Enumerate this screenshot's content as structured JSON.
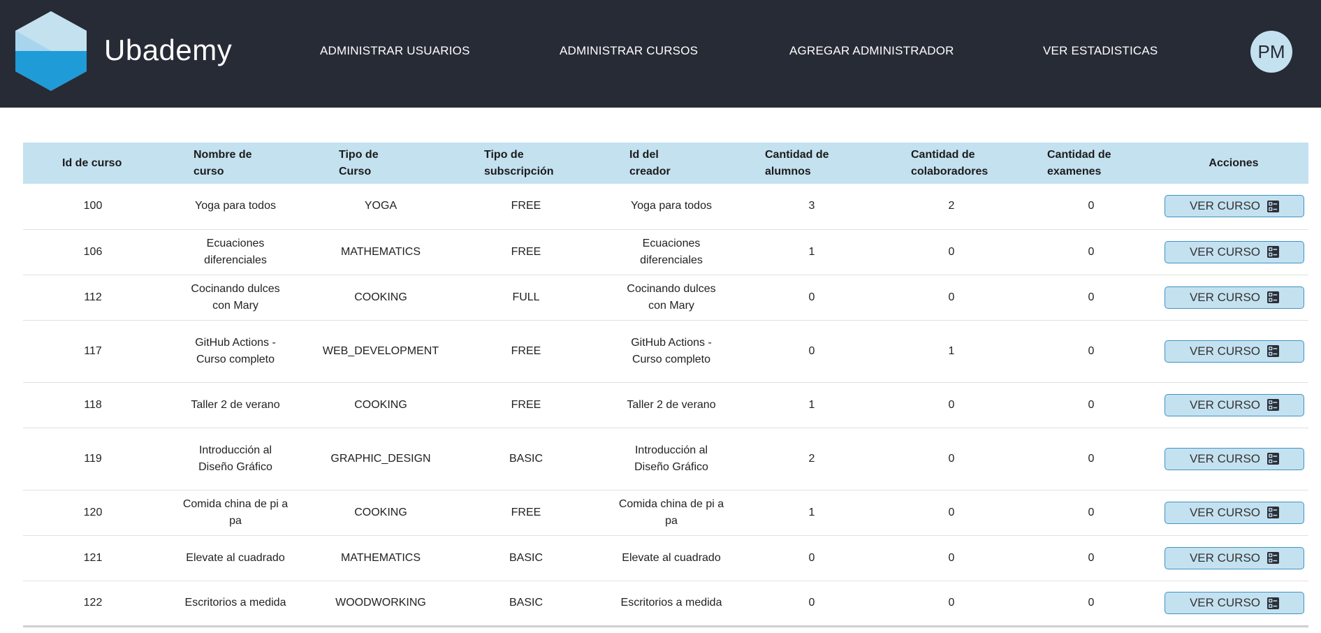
{
  "app": {
    "brand": "Ubademy",
    "avatar_initials": "PM",
    "colors": {
      "topbar": "#272b36",
      "header_row": "#c4e1f0",
      "button_border": "#3f93c4"
    }
  },
  "nav": {
    "items": [
      {
        "label": "ADMINISTRAR USUARIOS"
      },
      {
        "label": "ADMINISTRAR CURSOS"
      },
      {
        "label": "AGREGAR ADMINISTRADOR"
      },
      {
        "label": "VER ESTADISTICAS"
      }
    ]
  },
  "table": {
    "headers": {
      "id": [
        "Id de curso"
      ],
      "nombre": [
        "Nombre de",
        "curso"
      ],
      "tipo": [
        "Tipo de",
        "Curso"
      ],
      "suscripcion": [
        "Tipo de",
        "subscripción"
      ],
      "creador": [
        "Id del",
        "creador"
      ],
      "alumnos": [
        "Cantidad de",
        "alumnos"
      ],
      "colaboradores": [
        "Cantidad de",
        "colaboradores"
      ],
      "examenes": [
        "Cantidad de",
        "examenes"
      ],
      "acciones": [
        "Acciones"
      ]
    },
    "action_label": "VER CURSO",
    "action_icon": "list-details-icon",
    "rows": [
      {
        "id": "100",
        "nombre": "Yoga para todos",
        "tipo": "YOGA",
        "suscripcion": "FREE",
        "creador": "Yoga para todos",
        "alumnos": "3",
        "colaboradores": "2",
        "examenes": "0"
      },
      {
        "id": "106",
        "nombre": "Ecuaciones diferenciales",
        "tipo": "MATHEMATICS",
        "suscripcion": "FREE",
        "creador": "Ecuaciones diferenciales",
        "alumnos": "1",
        "colaboradores": "0",
        "examenes": "0"
      },
      {
        "id": "112",
        "nombre": "Cocinando dulces con Mary",
        "tipo": "COOKING",
        "suscripcion": "FULL",
        "creador": "Cocinando dulces con Mary",
        "alumnos": "0",
        "colaboradores": "0",
        "examenes": "0"
      },
      {
        "id": "117",
        "nombre": "GitHub Actions - Curso completo",
        "tipo": "WEB_DEVELOPMENT",
        "suscripcion": "FREE",
        "creador": "GitHub Actions - Curso completo",
        "alumnos": "0",
        "colaboradores": "1",
        "examenes": "0"
      },
      {
        "id": "118",
        "nombre": "Taller 2 de verano",
        "tipo": "COOKING",
        "suscripcion": "FREE",
        "creador": "Taller 2 de verano",
        "alumnos": "1",
        "colaboradores": "0",
        "examenes": "0"
      },
      {
        "id": "119",
        "nombre": "Introducción al Diseño Gráfico",
        "tipo": "GRAPHIC_DESIGN",
        "suscripcion": "BASIC",
        "creador": "Introducción al Diseño Gráfico",
        "alumnos": "2",
        "colaboradores": "0",
        "examenes": "0"
      },
      {
        "id": "120",
        "nombre": "Comida china de pi a pa",
        "tipo": "COOKING",
        "suscripcion": "FREE",
        "creador": "Comida china de pi a pa",
        "alumnos": "1",
        "colaboradores": "0",
        "examenes": "0"
      },
      {
        "id": "121",
        "nombre": "Elevate al cuadrado",
        "tipo": "MATHEMATICS",
        "suscripcion": "BASIC",
        "creador": "Elevate al cuadrado",
        "alumnos": "0",
        "colaboradores": "0",
        "examenes": "0"
      },
      {
        "id": "122",
        "nombre": "Escritorios a medida",
        "tipo": "WOODWORKING",
        "suscripcion": "BASIC",
        "creador": "Escritorios a medida",
        "alumnos": "0",
        "colaboradores": "0",
        "examenes": "0"
      }
    ]
  }
}
